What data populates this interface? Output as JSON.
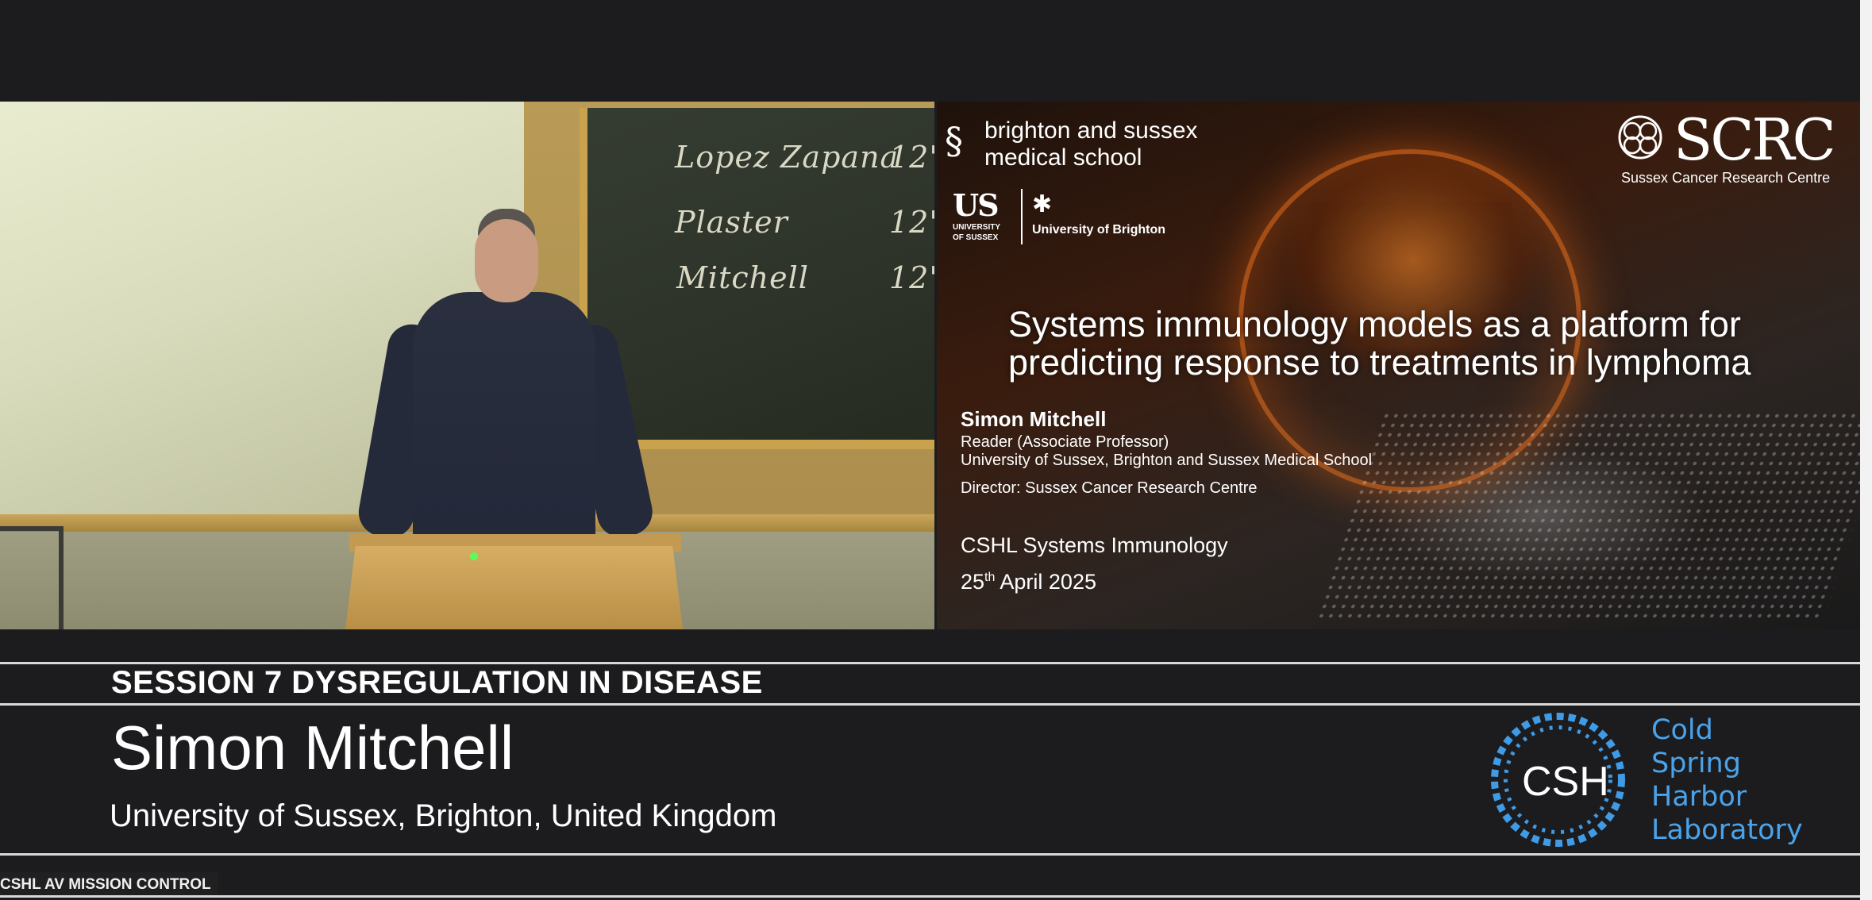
{
  "camera": {
    "chalkboard_lines": [
      {
        "name": "Lopez Zapana",
        "time": "12'"
      },
      {
        "name": "Plaster",
        "time": "12'"
      },
      {
        "name": "Mitchell",
        "time": "12'"
      }
    ]
  },
  "slide": {
    "bsms_line1": "brighton and sussex",
    "bsms_line2": "medical school",
    "us_mark": "US",
    "us_sub1": "UNIVERSITY",
    "us_sub2": "OF SUSSEX",
    "ub_label": "University of Brighton",
    "scrc_name": "SCRC",
    "scrc_sub": "Sussex Cancer Research Centre",
    "title_line1": "Systems immunology models as a platform for",
    "title_line2": "predicting response to treatments in lymphoma",
    "speaker_name": "Simon Mitchell",
    "speaker_role": "Reader (Associate Professor)",
    "speaker_affiliation": "University of Sussex, Brighton and Sussex Medical School",
    "speaker_director": "Director: Sussex Cancer Research Centre",
    "event_name": "CSHL Systems Immunology",
    "event_date_day": "25",
    "event_date_suffix": "th",
    "event_date_rest": " April 2025"
  },
  "lower_third": {
    "session": "SESSION 7 DYSREGULATION IN DISEASE",
    "presenter": "Simon Mitchell",
    "affiliation": "University of Sussex, Brighton, United Kingdom"
  },
  "logo": {
    "csh": "CSH",
    "lines": [
      "Cold",
      "Spring",
      "Harbor",
      "Laboratory"
    ],
    "color": "#4aa3ea"
  },
  "footer": {
    "control_label": "CSHL AV MISSION CONTROL"
  }
}
